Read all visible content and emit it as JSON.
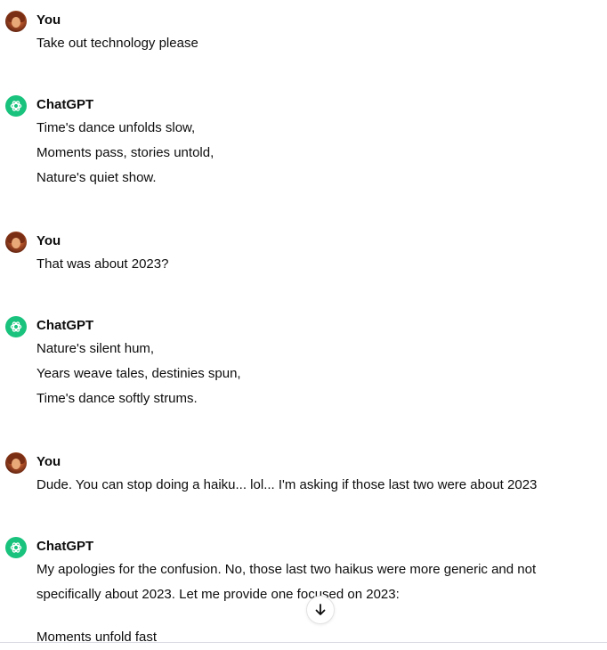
{
  "thread": {
    "messages": [
      {
        "author": "You",
        "role": "user",
        "lines": [
          "Take out technology please"
        ]
      },
      {
        "author": "ChatGPT",
        "role": "assistant",
        "lines": [
          "Time's dance unfolds slow,",
          "Moments pass, stories untold,",
          "Nature's quiet show."
        ]
      },
      {
        "author": "You",
        "role": "user",
        "lines": [
          "That was about 2023?"
        ]
      },
      {
        "author": "ChatGPT",
        "role": "assistant",
        "lines": [
          "Nature's silent hum,",
          "Years weave tales, destinies spun,",
          "Time's dance softly strums."
        ]
      },
      {
        "author": "You",
        "role": "user",
        "lines": [
          "Dude. You can stop doing a haiku... lol... I'm asking if those last two were about 2023"
        ]
      },
      {
        "author": "ChatGPT",
        "role": "assistant",
        "lines": [
          "My apologies for the confusion. No, those last two haikus were more generic and not",
          "specifically about 2023. Let me provide one focused on 2023:",
          "Moments unfold fast"
        ]
      }
    ]
  },
  "icons": {
    "user_avatar": "user-avatar-icon",
    "assistant_avatar": "openai-logo-icon",
    "scroll": "arrow-down-icon"
  },
  "colors": {
    "assistant_avatar_bg": "#19c37d",
    "text": "#0d0d0d"
  }
}
